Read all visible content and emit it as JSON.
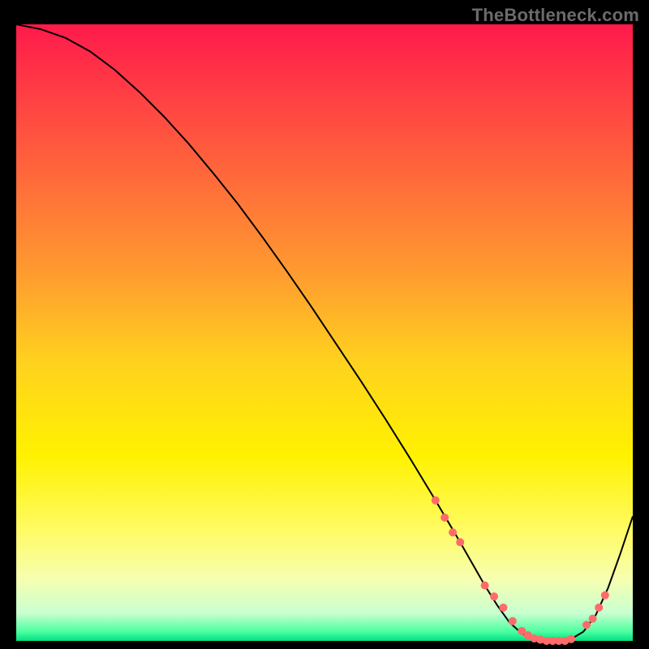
{
  "watermark": "TheBottleneck.com",
  "chart_data": {
    "type": "line",
    "title": "",
    "xlabel": "",
    "ylabel": "",
    "xlim": [
      0,
      100
    ],
    "ylim": [
      0,
      100
    ],
    "grid": false,
    "legend": false,
    "background_gradient_stops": [
      {
        "offset": 0.0,
        "color": "#ff1a4b"
      },
      {
        "offset": 0.1,
        "color": "#ff3a45"
      },
      {
        "offset": 0.25,
        "color": "#ff6a3a"
      },
      {
        "offset": 0.4,
        "color": "#ff9a30"
      },
      {
        "offset": 0.55,
        "color": "#ffd21e"
      },
      {
        "offset": 0.7,
        "color": "#fff200"
      },
      {
        "offset": 0.82,
        "color": "#fffb63"
      },
      {
        "offset": 0.9,
        "color": "#f6ffb0"
      },
      {
        "offset": 0.955,
        "color": "#c9ffd0"
      },
      {
        "offset": 0.985,
        "color": "#4cffa0"
      },
      {
        "offset": 1.0,
        "color": "#00e080"
      }
    ],
    "series": [
      {
        "name": "bottleneck-curve",
        "color": "#000000",
        "stroke_width": 2,
        "x": [
          0,
          4,
          8,
          12,
          16,
          20,
          24,
          28,
          32,
          36,
          40,
          44,
          48,
          52,
          56,
          60,
          64,
          68,
          70,
          72,
          74,
          76,
          78,
          80,
          82,
          84,
          86,
          88,
          90,
          92,
          94,
          96,
          98,
          100
        ],
        "y": [
          100,
          99.2,
          97.8,
          95.6,
          92.6,
          89.0,
          85.0,
          80.6,
          75.8,
          70.8,
          65.4,
          59.8,
          54.0,
          48.0,
          42.0,
          35.8,
          29.4,
          22.8,
          19.4,
          16.0,
          12.5,
          9.0,
          5.8,
          3.0,
          1.2,
          0.3,
          0.0,
          0.0,
          0.3,
          1.5,
          4.2,
          8.6,
          14.2,
          20.2
        ]
      }
    ],
    "markers": {
      "name": "highlight-dots",
      "color": "#ff6a6a",
      "radius": 5,
      "x": [
        68,
        69.5,
        70.8,
        72.0,
        76.0,
        77.5,
        79.0,
        80.5,
        82.0,
        83.0,
        84.0,
        85.0,
        86.0,
        87.0,
        88.0,
        89.0,
        90.0,
        92.5,
        93.5,
        94.5,
        95.5
      ],
      "y": [
        22.8,
        20.0,
        17.6,
        16.0,
        9.0,
        7.2,
        5.4,
        3.2,
        1.6,
        0.9,
        0.4,
        0.2,
        0.0,
        0.0,
        0.0,
        0.0,
        0.3,
        2.6,
        3.6,
        5.4,
        7.4
      ]
    }
  }
}
